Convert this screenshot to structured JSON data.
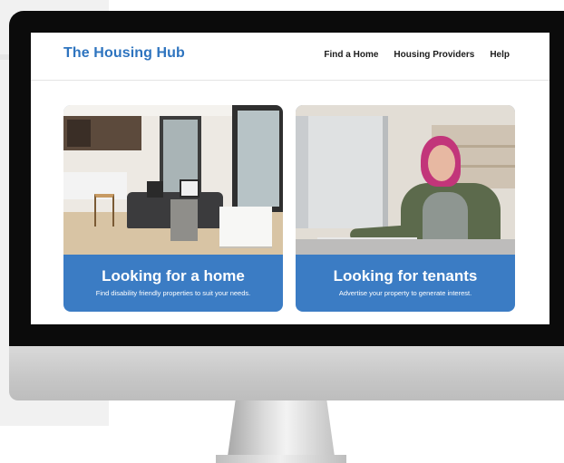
{
  "site": {
    "logo": "The Housing Hub"
  },
  "nav": {
    "items": [
      "Find a Home",
      "Housing Providers",
      "Help"
    ]
  },
  "cards": [
    {
      "title": "Looking for a home",
      "subtitle": "Find disability friendly properties to suit your needs."
    },
    {
      "title": "Looking for tenants",
      "subtitle": "Advertise your property to generate interest."
    }
  ],
  "colors": {
    "brand_blue": "#2e74bf",
    "card_blue": "#3b7cc4",
    "bezel": "#0b0b0b"
  }
}
